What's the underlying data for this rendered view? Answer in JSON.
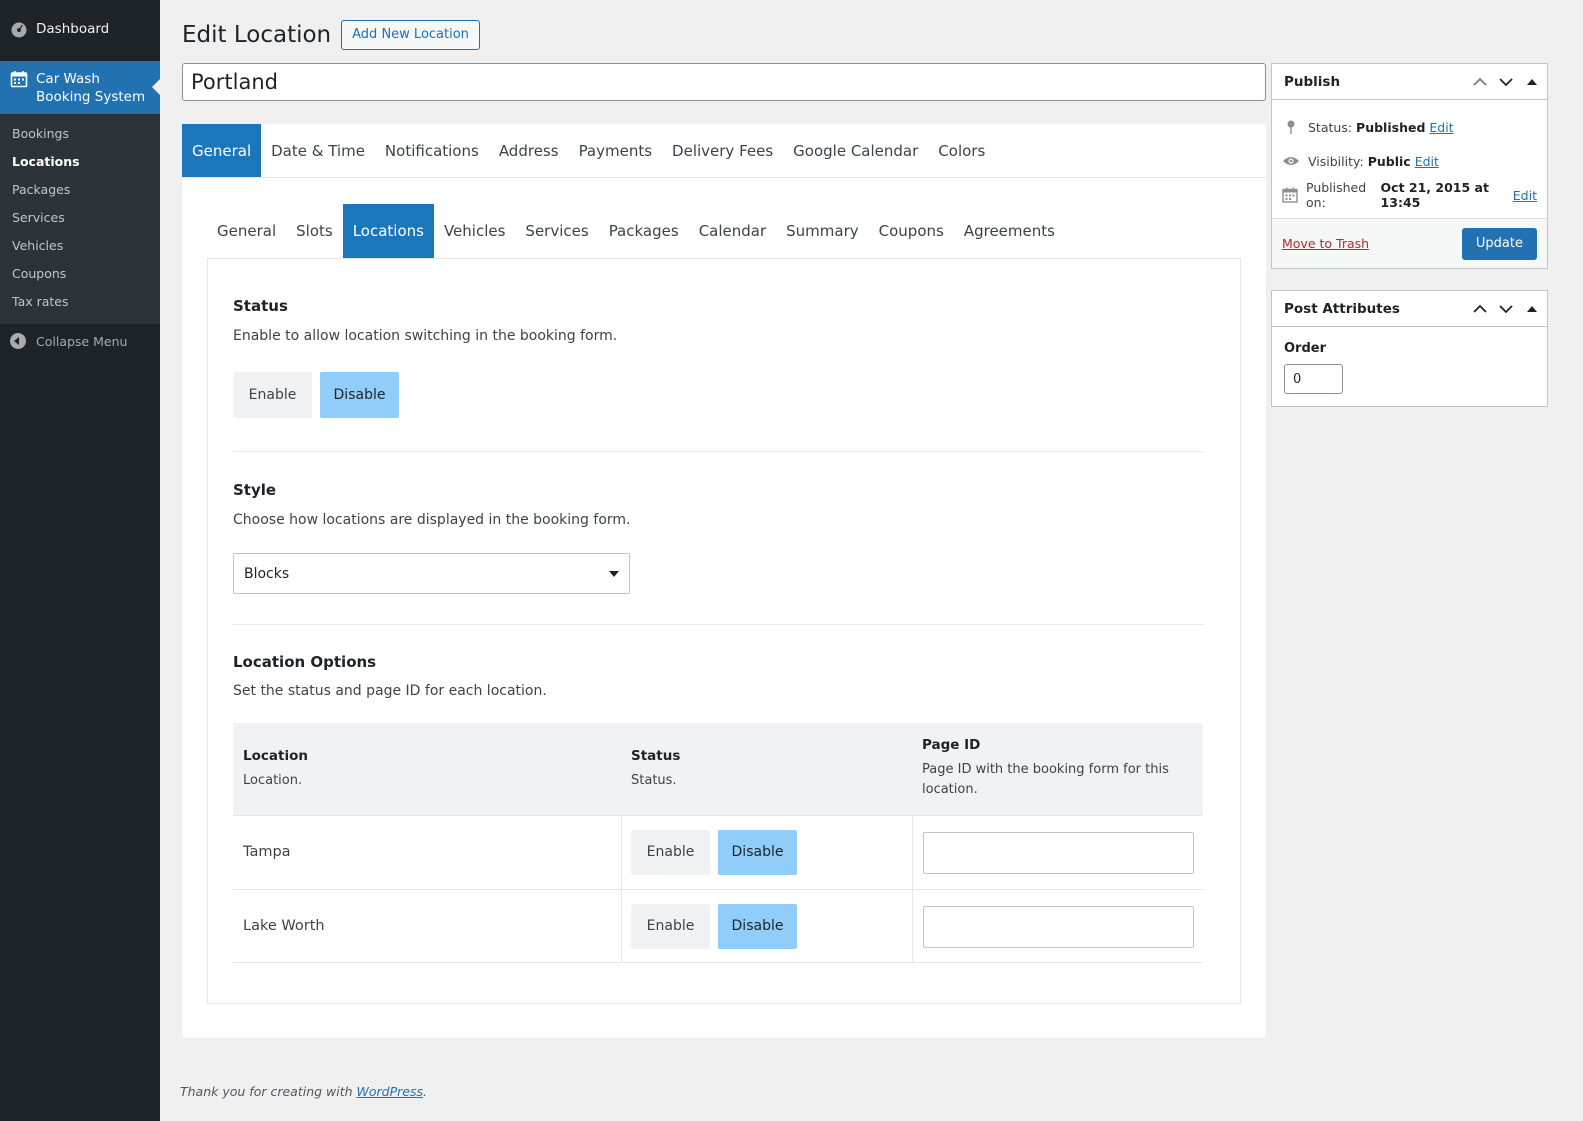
{
  "sidebar": {
    "dashboard": "Dashboard",
    "plugin_line1": "Car Wash",
    "plugin_line2": "Booking System",
    "submenu": [
      "Bookings",
      "Locations",
      "Packages",
      "Services",
      "Vehicles",
      "Coupons",
      "Tax rates"
    ],
    "collapse": "Collapse Menu"
  },
  "header": {
    "title": "Edit Location",
    "add_new": "Add New Location"
  },
  "post_title": "Portland",
  "tabs_main": [
    "General",
    "Date & Time",
    "Notifications",
    "Address",
    "Payments",
    "Delivery Fees",
    "Google Calendar",
    "Colors"
  ],
  "tabs_sub": [
    "General",
    "Slots",
    "Locations",
    "Vehicles",
    "Services",
    "Packages",
    "Calendar",
    "Summary",
    "Coupons",
    "Agreements"
  ],
  "status": {
    "title": "Status",
    "desc": "Enable to allow location switching in the booking form.",
    "enable": "Enable",
    "disable": "Disable"
  },
  "style": {
    "title": "Style",
    "desc": "Choose how locations are displayed in the booking form.",
    "selected": "Blocks"
  },
  "options": {
    "title": "Location Options",
    "desc": "Set the status and page ID for each location.",
    "col_location": "Location",
    "col_location_desc": "Location.",
    "col_status": "Status",
    "col_status_desc": "Status.",
    "col_pageid": "Page ID",
    "col_pageid_desc": "Page ID with the booking form for this location.",
    "rows": [
      {
        "name": "Tampa",
        "enable": "Enable",
        "disable": "Disable",
        "page_id": ""
      },
      {
        "name": "Lake Worth",
        "enable": "Enable",
        "disable": "Disable",
        "page_id": ""
      }
    ]
  },
  "publish": {
    "title": "Publish",
    "status_label": "Status:",
    "status_value": "Published",
    "visibility_label": "Visibility:",
    "visibility_value": "Public",
    "published_label": "Published on:",
    "published_value": "Oct 21, 2015 at 13:45",
    "edit": "Edit",
    "trash": "Move to Trash",
    "update": "Update"
  },
  "attributes": {
    "title": "Post Attributes",
    "order_label": "Order",
    "order_value": "0"
  },
  "footer": {
    "text": "Thank you for creating with ",
    "link": "WordPress",
    "period": "."
  },
  "colors": {
    "accent": "#2271b1",
    "active_tab": "#1b76bc",
    "toggle_on": "#90cdf9",
    "sidebar": "#1d2327"
  }
}
